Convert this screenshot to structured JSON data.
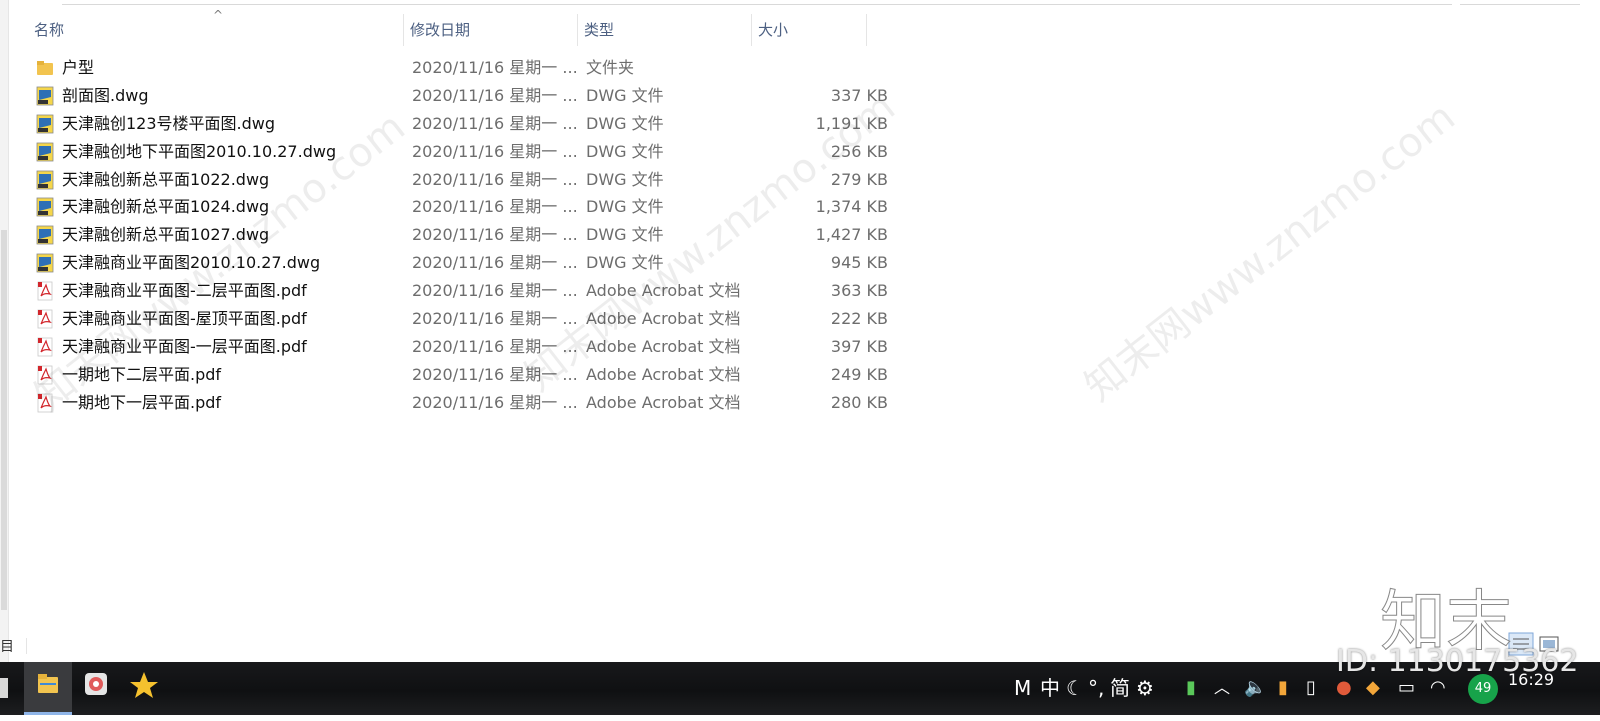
{
  "columns": {
    "name": "名称",
    "date": "修改日期",
    "type": "类型",
    "size": "大小"
  },
  "files": [
    {
      "name": "户型",
      "date": "2020/11/16 星期一 ...",
      "type": "文件夹",
      "size": "",
      "icon": "folder-icon"
    },
    {
      "name": "剖面图.dwg",
      "date": "2020/11/16 星期一 ...",
      "type": "DWG 文件",
      "size": "337 KB",
      "icon": "dwg-file-icon"
    },
    {
      "name": "天津融创123号楼平面图.dwg",
      "date": "2020/11/16 星期一 ...",
      "type": "DWG 文件",
      "size": "1,191 KB",
      "icon": "dwg-file-icon"
    },
    {
      "name": "天津融创地下平面图2010.10.27.dwg",
      "date": "2020/11/16 星期一 ...",
      "type": "DWG 文件",
      "size": "256 KB",
      "icon": "dwg-file-icon"
    },
    {
      "name": "天津融创新总平面1022.dwg",
      "date": "2020/11/16 星期一 ...",
      "type": "DWG 文件",
      "size": "279 KB",
      "icon": "dwg-file-icon"
    },
    {
      "name": "天津融创新总平面1024.dwg",
      "date": "2020/11/16 星期一 ...",
      "type": "DWG 文件",
      "size": "1,374 KB",
      "icon": "dwg-file-icon"
    },
    {
      "name": "天津融创新总平面1027.dwg",
      "date": "2020/11/16 星期一 ...",
      "type": "DWG 文件",
      "size": "1,427 KB",
      "icon": "dwg-file-icon"
    },
    {
      "name": "天津融商业平面图2010.10.27.dwg",
      "date": "2020/11/16 星期一 ...",
      "type": "DWG 文件",
      "size": "945 KB",
      "icon": "dwg-file-icon"
    },
    {
      "name": "天津融商业平面图-二层平面图.pdf",
      "date": "2020/11/16 星期一 ...",
      "type": "Adobe Acrobat 文档",
      "size": "363 KB",
      "icon": "pdf-file-icon"
    },
    {
      "name": "天津融商业平面图-屋顶平面图.pdf",
      "date": "2020/11/16 星期一 ...",
      "type": "Adobe Acrobat 文档",
      "size": "222 KB",
      "icon": "pdf-file-icon"
    },
    {
      "name": "天津融商业平面图-一层平面图.pdf",
      "date": "2020/11/16 星期一 ...",
      "type": "Adobe Acrobat 文档",
      "size": "397 KB",
      "icon": "pdf-file-icon"
    },
    {
      "name": "一期地下二层平面.pdf",
      "date": "2020/11/16 星期一 ...",
      "type": "Adobe Acrobat 文档",
      "size": "249 KB",
      "icon": "pdf-file-icon"
    },
    {
      "name": "一期地下一层平面.pdf",
      "date": "2020/11/16 星期一 ...",
      "type": "Adobe Acrobat 文档",
      "size": "280 KB",
      "icon": "pdf-file-icon"
    }
  ],
  "status": {
    "items_label": "目"
  },
  "taskbar": {
    "ime_mode": "M",
    "ime_lang": "中",
    "ime_punct": "°,",
    "ime_simplified": "简",
    "badge_count": "49",
    "clock": "16:29"
  },
  "watermarks": {
    "diagonal": "知末网www.znzmo.com",
    "logo": "知末",
    "id": "ID: 1130175362"
  }
}
